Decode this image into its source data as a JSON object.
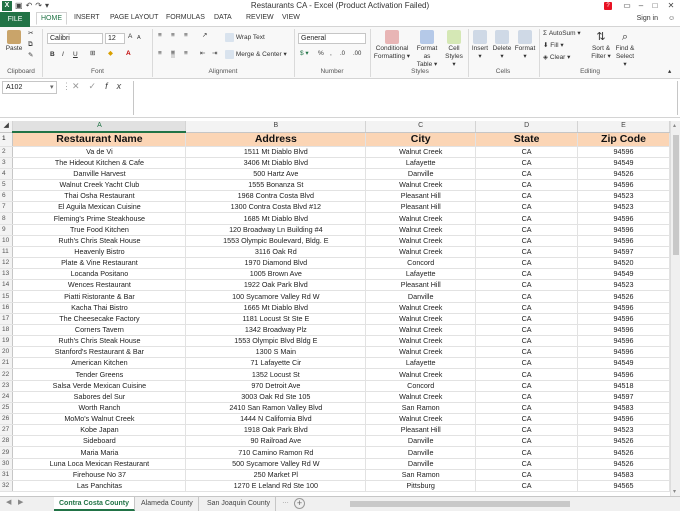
{
  "app": {
    "title": "Restaurants CA -  Excel (Product Activation Failed)",
    "sign_in": "Sign in"
  },
  "ribbon_tabs": [
    "FILE",
    "HOME",
    "INSERT",
    "PAGE LAYOUT",
    "FORMULAS",
    "DATA",
    "REVIEW",
    "VIEW"
  ],
  "ribbon": {
    "clipboard": {
      "label": "Clipboard",
      "paste": "Paste"
    },
    "font": {
      "label": "Font",
      "name": "Calibri",
      "size": "12",
      "bold": "B",
      "italic": "I",
      "underline": "U"
    },
    "alignment": {
      "label": "Alignment",
      "wrap_text": "Wrap Text",
      "merge_center": "Merge & Center"
    },
    "number": {
      "label": "Number",
      "format": "General"
    },
    "styles": {
      "label": "Styles",
      "conditional": "Conditional",
      "conditional2": "Formatting",
      "format_as": "Format as",
      "format_as2": "Table",
      "cell": "Cell",
      "cell2": "Styles"
    },
    "cells": {
      "label": "Cells",
      "insert": "Insert",
      "delete": "Delete",
      "format": "Format"
    },
    "editing": {
      "label": "Editing",
      "autosum": "AutoSum",
      "fill": "Fill",
      "clear": "Clear",
      "sort": "Sort &",
      "sort2": "Filter",
      "find": "Find &",
      "find2": "Select"
    }
  },
  "formula_bar": {
    "name_box": "A102",
    "fx": "fx",
    "value": ""
  },
  "columns": [
    "A",
    "B",
    "C",
    "D",
    "E"
  ],
  "headers": [
    "Restaurant Name",
    "Address",
    "City",
    "State",
    "Zip Code"
  ],
  "rows": [
    [
      "Va de Vi",
      "1511 Mt Diablo Blvd",
      "Walnut Creek",
      "CA",
      "94596"
    ],
    [
      "The Hideout Kitchen & Cafe",
      "3406 Mt Diablo Blvd",
      "Lafayette",
      "CA",
      "94549"
    ],
    [
      "Danville Harvest",
      "500 Hartz Ave",
      "Danville",
      "CA",
      "94526"
    ],
    [
      "Walnut Creek Yacht Club",
      "1555 Bonanza St",
      "Walnut Creek",
      "CA",
      "94596"
    ],
    [
      "Thai Osha Restaurant",
      "1968 Contra Costa Blvd",
      "Pleasant Hill",
      "CA",
      "94523"
    ],
    [
      "El Aguila Mexican Cuisine",
      "1300 Contra Costa Blvd #12",
      "Pleasant Hill",
      "CA",
      "94523"
    ],
    [
      "Fleming's Prime Steakhouse",
      "1685 Mt Diablo Blvd",
      "Walnut Creek",
      "CA",
      "94596"
    ],
    [
      "True Food Kitchen",
      "120 Broadway Ln Building #4",
      "Walnut Creek",
      "CA",
      "94596"
    ],
    [
      "Ruth's Chris Steak House",
      "1553 Olympic Boulevard, Bldg. E",
      "Walnut Creek",
      "CA",
      "94596"
    ],
    [
      "Heavenly Bistro",
      "3116 Oak Rd",
      "Walnut Creek",
      "CA",
      "94597"
    ],
    [
      "Plate & Vine Restaurant",
      "1970 Diamond Blvd",
      "Concord",
      "CA",
      "94520"
    ],
    [
      "Locanda Positano",
      "1005 Brown Ave",
      "Lafayette",
      "CA",
      "94549"
    ],
    [
      "Wences Restaurant",
      "1922 Oak Park Blvd",
      "Pleasant Hill",
      "CA",
      "94523"
    ],
    [
      "Piatti Ristorante & Bar",
      "100 Sycamore Valley Rd W",
      "Danville",
      "CA",
      "94526"
    ],
    [
      "Kacha Thai Bistro",
      "1665 Mt Diablo Blvd",
      "Walnut Creek",
      "CA",
      "94596"
    ],
    [
      "The Cheesecake Factory",
      "1181 Locust St Ste E",
      "Walnut Creek",
      "CA",
      "94596"
    ],
    [
      "Corners Tavern",
      "1342 Broadway Plz",
      "Walnut Creek",
      "CA",
      "94596"
    ],
    [
      "Ruth's Chris Steak House",
      "1553 Olympic Blvd Bldg E",
      "Walnut Creek",
      "CA",
      "94596"
    ],
    [
      "Stanford's Restaurant & Bar",
      "1300 S Main",
      "Walnut Creek",
      "CA",
      "94596"
    ],
    [
      "American Kitchen",
      "71 Lafayette Cir",
      "Lafayette",
      "CA",
      "94549"
    ],
    [
      "Tender Greens",
      "1352 Locust St",
      "Walnut Creek",
      "CA",
      "94596"
    ],
    [
      "Salsa Verde Mexican Cuisine",
      "970 Detroit Ave",
      "Concord",
      "CA",
      "94518"
    ],
    [
      "Sabores del Sur",
      "3003 Oak Rd Ste 105",
      "Walnut Creek",
      "CA",
      "94597"
    ],
    [
      "Worth Ranch",
      "2410 San Ramon Valley Blvd",
      "San Ramon",
      "CA",
      "94583"
    ],
    [
      "MoMo's Walnut Creek",
      "1444 N California Blvd",
      "Walnut Creek",
      "CA",
      "94596"
    ],
    [
      "Kobe Japan",
      "1918 Oak Park Blvd",
      "Pleasant Hill",
      "CA",
      "94523"
    ],
    [
      "Sideboard",
      "90 Railroad Ave",
      "Danville",
      "CA",
      "94526"
    ],
    [
      "Maria Maria",
      "710 Camino Ramon Rd",
      "Danville",
      "CA",
      "94526"
    ],
    [
      "Luna Loca Mexican Restaurant",
      "500 Sycamore Valley Rd W",
      "Danville",
      "CA",
      "94526"
    ],
    [
      "Firehouse No 37",
      "250 Market Pl",
      "San Ramon",
      "CA",
      "94583"
    ],
    [
      "Las Panchitas",
      "1270 E Leland Rd Ste 100",
      "Pittsburg",
      "CA",
      "94565"
    ]
  ],
  "sheet_tabs": [
    "Contra Costa County",
    "Alameda County",
    "San Joaquin County"
  ],
  "colors": {
    "accent": "#217346",
    "title_bar_red": "#e81123",
    "header_fill": "#fbd5b5"
  }
}
